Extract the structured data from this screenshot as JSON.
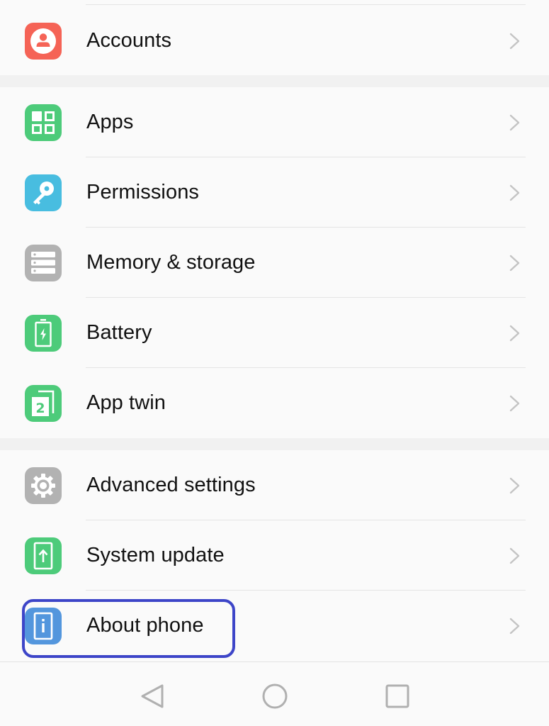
{
  "settings": {
    "sections": [
      {
        "items": [
          {
            "label": "Accounts",
            "icon": "account-icon",
            "color": "#f56356"
          }
        ]
      },
      {
        "items": [
          {
            "label": "Apps",
            "icon": "apps-grid-icon",
            "color": "#4dcb7a"
          },
          {
            "label": "Permissions",
            "icon": "key-icon",
            "color": "#48bde0"
          },
          {
            "label": "Memory & storage",
            "icon": "storage-icon",
            "color": "#b2b2b2"
          },
          {
            "label": "Battery",
            "icon": "battery-icon",
            "color": "#4dcb7a"
          },
          {
            "label": "App twin",
            "icon": "app-twin-icon",
            "color": "#4dcb7a"
          }
        ]
      },
      {
        "items": [
          {
            "label": "Advanced settings",
            "icon": "gear-icon",
            "color": "#b2b2b2"
          },
          {
            "label": "System update",
            "icon": "system-update-icon",
            "color": "#4dcb7a"
          },
          {
            "label": "About phone",
            "icon": "info-phone-icon",
            "color": "#5396dd",
            "highlighted": true
          }
        ]
      }
    ]
  },
  "highlight_color": "#3d45c8",
  "navbar": {
    "buttons": [
      {
        "name": "back",
        "icon": "back-triangle-icon"
      },
      {
        "name": "home",
        "icon": "home-circle-icon"
      },
      {
        "name": "recents",
        "icon": "recents-square-icon"
      }
    ],
    "icon_color": "#b0b0b0"
  }
}
